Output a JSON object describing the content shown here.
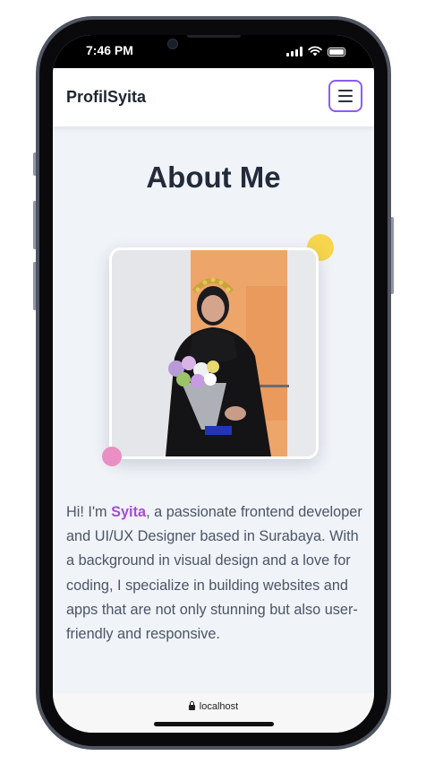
{
  "status_bar": {
    "time": "7:46 PM"
  },
  "navbar": {
    "brand": "ProfilSyita"
  },
  "page": {
    "heading": "About Me",
    "about_prefix": "Hi! I'm ",
    "about_name": "Syita",
    "about_suffix": ", a passionate frontend developer and UI/UX Designer based in Surabaya. With a background in visual design and a love for coding, I specialize in building websites and apps that are not only stunning but also user-friendly and responsive."
  },
  "url_bar": {
    "url": "localhost"
  },
  "colors": {
    "accent_purple": "#8b5cf6",
    "name_highlight": "#a64cd4",
    "dot_yellow": "#f7d64e",
    "dot_pink": "#ea8fc3",
    "page_bg": "#f0f3f8"
  },
  "icons": [
    "hamburger-menu-icon",
    "signal-icon",
    "wifi-icon",
    "battery-icon",
    "lock-icon"
  ]
}
